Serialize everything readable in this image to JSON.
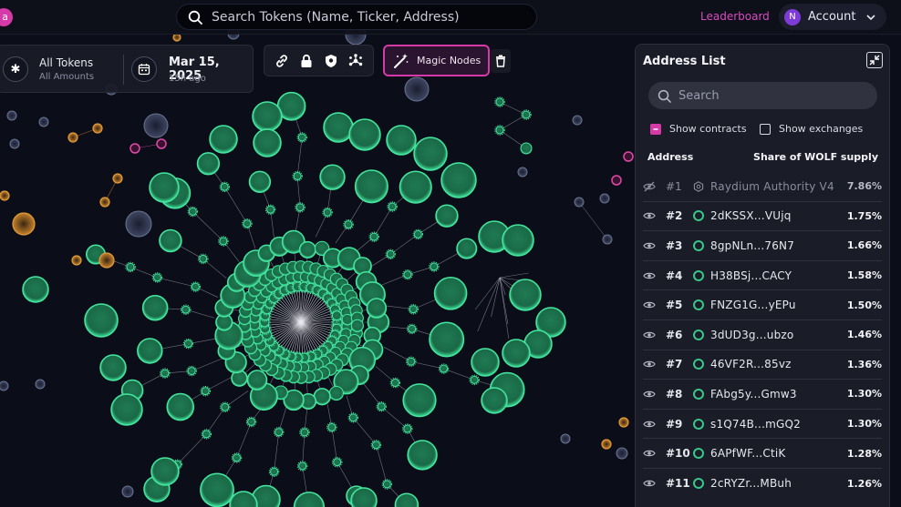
{
  "header": {
    "logo_letter": "a",
    "search_placeholder": "Search Tokens (Name, Ticker, Address)",
    "leaderboard_label": "Leaderboard",
    "account_initial": "N",
    "account_label": "Account"
  },
  "filters": {
    "tokens_title": "All Tokens",
    "tokens_sub": "All Amounts",
    "date": "Mar 15, 2025",
    "date_ago": "15h ago"
  },
  "toolbar": {
    "icons": [
      "link-icon",
      "lock-icon",
      "shield-icon",
      "nodes-icon"
    ],
    "magic_label": "Magic Nodes"
  },
  "address_list": {
    "title": "Address List",
    "search_placeholder": "Search",
    "show_contracts": "Show contracts",
    "show_exchanges": "Show exchanges",
    "col_address": "Address",
    "col_share": "Share of WOLF supply",
    "rows": [
      {
        "rank": "#1",
        "address": "Raydium Authority V4",
        "share": "7.86%",
        "contract": true
      },
      {
        "rank": "#2",
        "address": "2dKSSX...VUjq",
        "share": "1.75%"
      },
      {
        "rank": "#3",
        "address": "8gpNLn...76N7",
        "share": "1.66%"
      },
      {
        "rank": "#4",
        "address": "H38BSj...CACY",
        "share": "1.58%"
      },
      {
        "rank": "#5",
        "address": "FNZG1G...yEPu",
        "share": "1.50%"
      },
      {
        "rank": "#6",
        "address": "3dUD3g...ubzo",
        "share": "1.46%"
      },
      {
        "rank": "#7",
        "address": "46VF2R...85vz",
        "share": "1.36%"
      },
      {
        "rank": "#8",
        "address": "FAbg5y...Gmw3",
        "share": "1.30%"
      },
      {
        "rank": "#9",
        "address": "s1Q74B...mGQ2",
        "share": "1.30%"
      },
      {
        "rank": "#10",
        "address": "6APfWF...CtiK",
        "share": "1.28%"
      },
      {
        "rank": "#11",
        "address": "2cRYZr...MBuh",
        "share": "1.26%"
      }
    ]
  },
  "colors": {
    "accent": "#d63aa8",
    "node_green": "#2fbf7a",
    "node_orange": "#e0892a",
    "node_gray": "#8890a8"
  }
}
